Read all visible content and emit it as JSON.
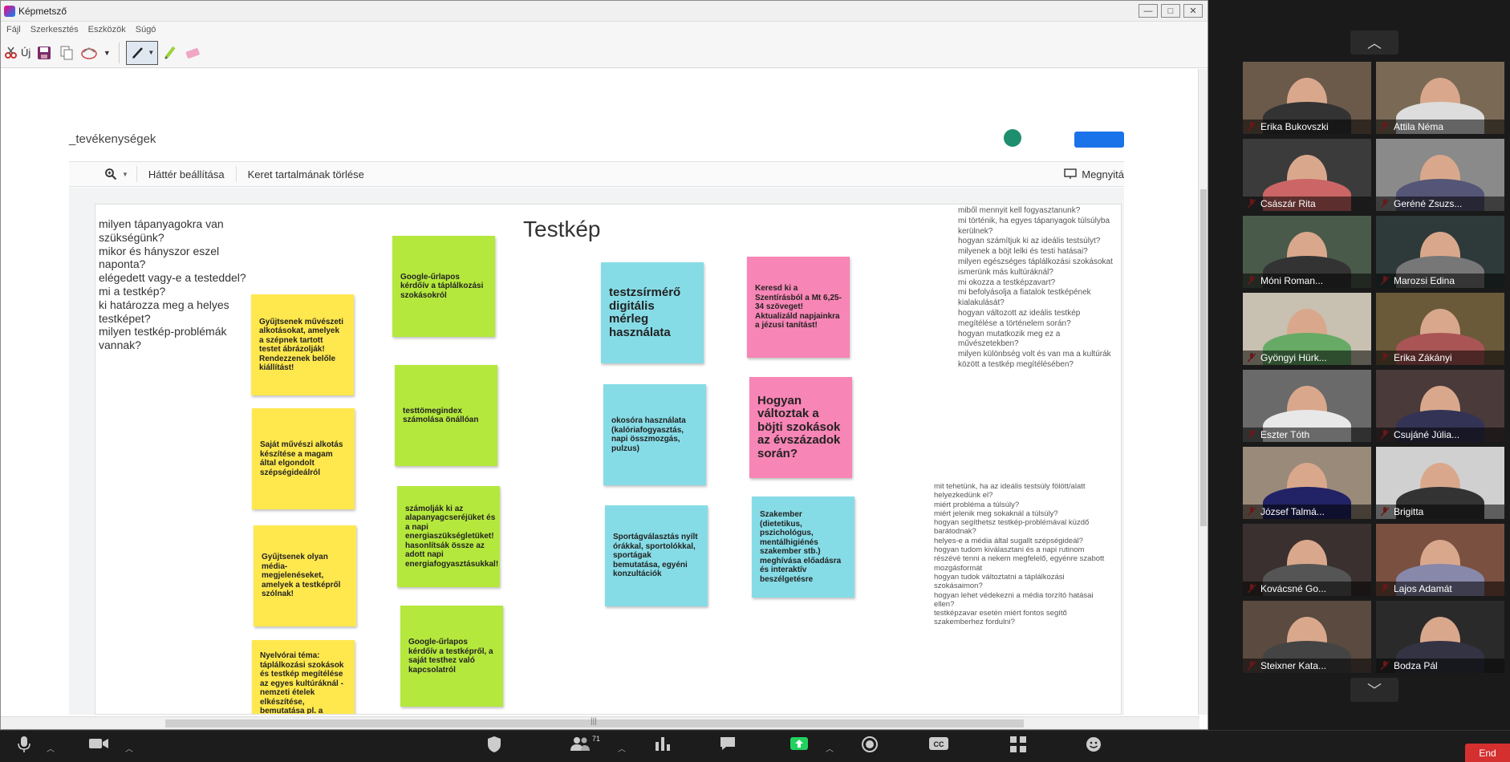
{
  "window": {
    "title": "Képmetsző",
    "menu": [
      "Fájl",
      "Szerkesztés",
      "Eszközök",
      "Súgó"
    ],
    "toolbar": {
      "new_label": "Új"
    }
  },
  "slides": {
    "doc_title": "_tevékenységek",
    "toolbar": {
      "background": "Háttér beállítása",
      "clear": "Keret tartalmának törlése",
      "present": "Megnyitá"
    }
  },
  "slide": {
    "title": "Testkép",
    "questions": "milyen tápanyagokra van szükségünk?\nmikor és hányszor eszel naponta?\nelégedett vagy-e a testeddel?\nmi a testkép?\nki határozza meg a helyes testképet?\nmilyen testkép-problémák vannak?",
    "notes": {
      "y1": "Gyűjtsenek művészeti alkotásokat, amelyek a szépnek tartott testet ábrázolják! Rendezzenek belőle kiállítást!",
      "y2": "Saját művészi alkotás készítése a magam által elgondolt szépségideálról",
      "y3": "Gyűjtsenek olyan média-megjelenéseket, amelyek a testképről szólnak!",
      "y4": "Nyelvórai téma: táplálkozási szokások és testkép megítélése az egyes kultúráknál - nemzeti ételek elkészítése, bemutatása pl. a",
      "g1": "Google-űrlapos kérdőív a táplálkozási szokásokról",
      "g2": "testtömegindex számolása önállóan",
      "g3": "számolják ki az alapanyagcseréjüket és a napi energiaszükségletüket! hasonlítsák össze az adott napi energiafogyasztásukkal!",
      "g4": "Google-űrlapos kérdőív a testképről, a saját testhez való kapcsolatról",
      "c1": "testzsírmérő digitális mérleg használata",
      "c2": "okosóra használata (kalóriafogyasztás, napi összmozgás, pulzus)",
      "c3": "Sportágválasztás nyílt órákkal, sportolókkal, sportágak bemutatása, egyéni konzultációk",
      "c4": "Szakember (dietetikus, pszichológus, mentálhigiénés szakember stb.) meghívása előadásra és interaktív beszélgetésre",
      "p1": "Keresd ki a Szentírásból a Mt 6,25-34 szöveget! Aktualizáld napjainkra a jézusi tanítást!",
      "p2": "Hogyan változtak a böjti szokások az évszázadok során?"
    },
    "right_top": "miből mennyit kell fogyasztanunk?\nmi történik, ha egyes tápanyagok túlsúlyba kerülnek?\nhogyan számítjuk ki az ideális testsúlyt?\nmilyenek a böjt lelki és testi hatásai?\nmilyen egészséges  táplálkozási szokásokat ismerünk más kultúráknál?\nmi okozza a testképzavart?\nmi befolyásolja a fiatalok testképének kialakulását?\nhogyan változott az ideális testkép megítélése a történelem során?\nhogyan mutatkozik meg ez a művészetekben?\nmilyen különbség volt és van ma a kultúrák között a testkép megítélésében?",
    "right_bottom": "mit tehetünk, ha az ideális testsúly fölött/alatt helyezkedünk el?\nmiért probléma a túlsúly?\nmiért jelenik meg sokaknál a túlsúly?\nhogyan segíthetsz testkép-problémával küzdő barátodnak?\nhelyes-e a média által sugallt szépségideál?\nhogyan tudom kiválasztani és a napi rutinom részévé tenni a nekem megfelelő, egyénre szabott mozgásformát\nhogyan tudok változtatni a táplálkozási szokásaimon?\nhogyan lehet védekezni a média torzító hatásai ellen?\ntestképzavar esetén miért fontos segítő szakemberhez fordulni?"
  },
  "participants": [
    "Erika Bukovszki",
    "Attila Néma",
    "Császár Rita",
    "Geréné Zsuzs...",
    "Móni Roman...",
    "Marozsi Edina",
    "Gyöngyi Hürk...",
    "Erika Zákányi",
    "Eszter Tóth",
    "Csujáné Júlia...",
    "József Talmá...",
    "Brigitta",
    "Kovácsné Go...",
    "Lajos Adamát",
    "Steixner Kata...",
    "Bodza Pál"
  ],
  "zoom": {
    "participants_count": "71",
    "end_label": "End"
  }
}
